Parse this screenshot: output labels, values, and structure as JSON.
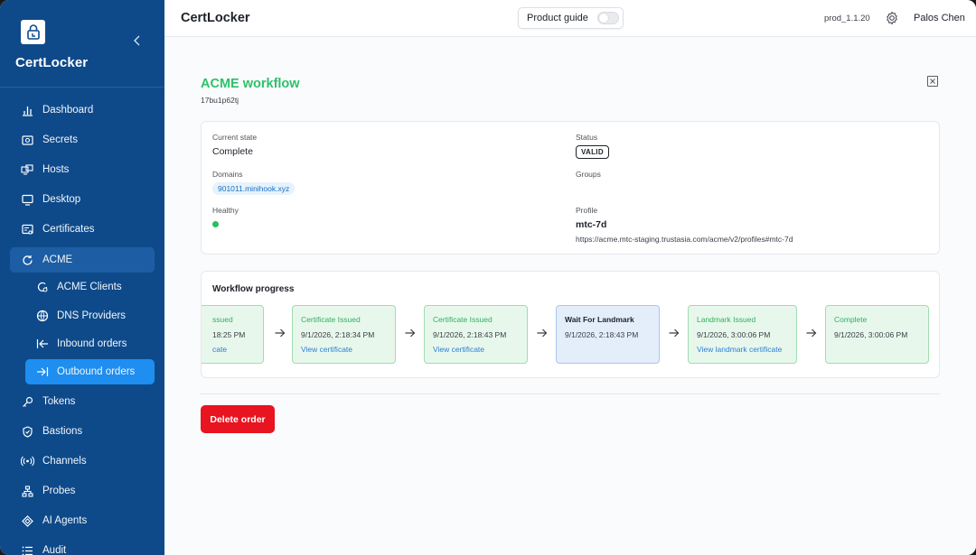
{
  "sidebar": {
    "brand": "CertLocker",
    "collapse_icon": "chevron-left-icon",
    "items": [
      {
        "label": "Dashboard",
        "icon": "bar-chart-icon"
      },
      {
        "label": "Secrets",
        "icon": "safe-icon"
      },
      {
        "label": "Hosts",
        "icon": "hosts-icon"
      },
      {
        "label": "Desktop",
        "icon": "monitor-icon"
      },
      {
        "label": "Certificates",
        "icon": "certificate-icon"
      },
      {
        "label": "ACME",
        "icon": "acme-icon"
      },
      {
        "label": "ACME Clients",
        "icon": "client-icon"
      },
      {
        "label": "DNS Providers",
        "icon": "globe-icon"
      },
      {
        "label": "Inbound orders",
        "icon": "inbound-icon"
      },
      {
        "label": "Outbound orders",
        "icon": "outbound-icon"
      },
      {
        "label": "Tokens",
        "icon": "key-icon"
      },
      {
        "label": "Bastions",
        "icon": "shield-icon"
      },
      {
        "label": "Channels",
        "icon": "broadcast-icon"
      },
      {
        "label": "Probes",
        "icon": "network-icon"
      },
      {
        "label": "AI Agents",
        "icon": "ai-icon"
      },
      {
        "label": "Audit",
        "icon": "list-icon"
      }
    ]
  },
  "header": {
    "title": "CertLocker",
    "product_guide": "Product guide",
    "product_guide_enabled": false,
    "version": "prod_1.1.20",
    "user": "Palos Chen"
  },
  "page": {
    "title": "ACME workflow",
    "id": "17bu1p62tj"
  },
  "info": {
    "current_state_label": "Current state",
    "current_state": "Complete",
    "status_label": "Status",
    "status": "VALID",
    "domains_label": "Domains",
    "domain": "901011.minihook.xyz",
    "groups_label": "Groups",
    "healthy_label": "Healthy",
    "healthy_color": "#23c05f",
    "profile_label": "Profile",
    "profile": "mtc-7d",
    "profile_url": "https://acme.mtc-staging.trustasia.com/acme/v2/profiles#mtc-7d"
  },
  "workflow": {
    "title": "Workflow progress",
    "steps": [
      {
        "title": "ssued",
        "time": "18:25 PM",
        "link": "cate"
      },
      {
        "title": "Certificate Issued",
        "time": "9/1/2026, 2:18:34 PM",
        "link": "View certificate"
      },
      {
        "title": "Certificate Issued",
        "time": "9/1/2026, 2:18:43 PM",
        "link": "View certificate"
      },
      {
        "title": "Wait For Landmark",
        "time": "9/1/2026, 2:18:43 PM",
        "link": ""
      },
      {
        "title": "Landmark Issued",
        "time": "9/1/2026, 3:00:06 PM",
        "link": "View landmark certificate"
      },
      {
        "title": "Complete",
        "time": "9/1/2026, 3:00:06 PM",
        "link": ""
      }
    ]
  },
  "actions": {
    "delete": "Delete order"
  },
  "colors": {
    "sidebar": "#0e4a8a",
    "accent_green": "#2ec16a",
    "delete_red": "#e8141f",
    "active_blue": "#1e8ef0"
  }
}
